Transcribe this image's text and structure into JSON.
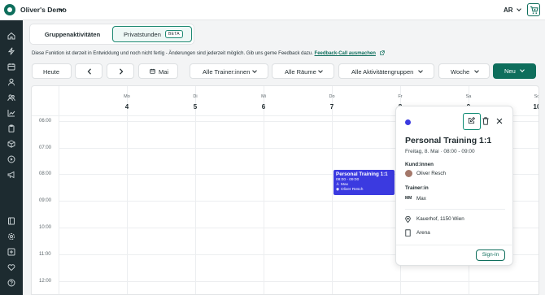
{
  "header": {
    "studio": "Oliver's Demo",
    "avatar_initials": "AR"
  },
  "tabs": {
    "group": "Gruppenaktivitäten",
    "private": "Privatstunden",
    "badge": "BETA"
  },
  "notice": {
    "text": "Diese Funktion ist derzeit in Entwicklung und noch nicht fertig - Änderungen sind jederzeit möglich. Gib uns gerne Feedback dazu.",
    "link": "Feedback-Call ausmachen"
  },
  "toolbar": {
    "today": "Heute",
    "month": "Mai",
    "trainers": "Alle Trainer:innen",
    "rooms": "Alle Räume",
    "groups": "Alle Aktivitätengruppen",
    "view": "Woche",
    "new": "Neu"
  },
  "calendar": {
    "days": [
      {
        "name": "Mo",
        "num": "4"
      },
      {
        "name": "Di",
        "num": "5"
      },
      {
        "name": "Mi",
        "num": "6"
      },
      {
        "name": "Do",
        "num": "7"
      },
      {
        "name": "Fr",
        "num": "8"
      },
      {
        "name": "Sa",
        "num": "9"
      },
      {
        "name": "So",
        "num": "10"
      }
    ],
    "times": [
      "06:00",
      "07:00",
      "08:00",
      "09:00",
      "10:00",
      "11:00",
      "12:00"
    ],
    "event": {
      "title": "Personal Training 1:1",
      "time": "08:00 - 09:00",
      "trainer": "Max",
      "client": "Oliver Resch"
    }
  },
  "popup": {
    "title": "Personal Training 1:1",
    "date": "Freitag, 8. Mai",
    "time": "08:00 - 09:00",
    "clients_label": "Kund:innen",
    "client": "Oliver Resch",
    "trainers_label": "Trainer:in",
    "trainer_initials": "MM",
    "trainer": "Max",
    "location": "Kauerhof, 1150 Wien",
    "room": "Arena",
    "signin": "Sign-In"
  },
  "colors": {
    "brand": "#0e6e5c",
    "event": "#3b3ae0",
    "sidebar": "#1d2b30"
  },
  "icons": {
    "sidebar": [
      "home-icon",
      "bolt-icon",
      "calendar-icon",
      "user-icon",
      "users-icon",
      "chart-icon",
      "clipboard-icon",
      "box-icon",
      "play-icon",
      "megaphone-icon",
      "book-icon",
      "settings-icon",
      "plus-square-icon",
      "heart-icon",
      "help-icon"
    ]
  }
}
